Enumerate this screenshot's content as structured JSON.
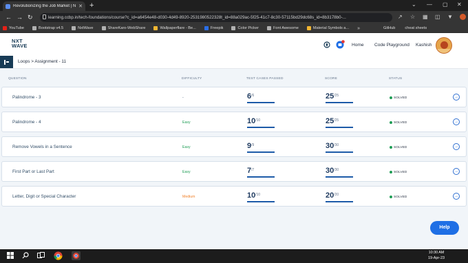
{
  "browser": {
    "tab_title": "Revolutionizing the Job Market | N",
    "tab_close": "✕",
    "new_tab": "+",
    "url": "learning.ccbp.in/tech-foundations/course?c_id=a6454e48-d030-4d49-8920-2531980522328t_id=88a029ac-5f25-41c7-8c30-57115bd29dc68s_id=8b3178b0-...",
    "window_controls": [
      "⌄",
      "—",
      "▢",
      "✕"
    ],
    "bookmarks": [
      "YouTube",
      "Bootstrap v4.5",
      "NxtWave",
      "ShareKaro-WebShare",
      "Wallpaperflare - Be...",
      "Freepik",
      "Color Picker",
      "Font Awesome",
      "Material Symbols a..."
    ],
    "bookmarks_overflow": "»",
    "bookmarks_right": [
      "GitHub",
      "cheat sheets"
    ],
    "colors": {
      "chrome_dark": "#353535",
      "tabstrip": "#1f1f1f"
    }
  },
  "header": {
    "logo_line1": "NXT",
    "logo_line2": "WAVE",
    "nav": [
      "Home",
      "Code Playground"
    ],
    "user_name": "Kashish",
    "notification_count": "1"
  },
  "breadcrumb": "Loops > Assignment - 11",
  "table": {
    "columns": [
      "QUESTION",
      "DIFFICULTY",
      "TEST CASES PASSED",
      "SCORE",
      "STATUS"
    ],
    "rows": [
      {
        "question": "Palindrome - 3",
        "difficulty": "-",
        "difficulty_level": "none",
        "passed": "6",
        "passed_total": "/6",
        "score": "25",
        "score_total": "/25",
        "status": "SOLVED"
      },
      {
        "question": "Palindrome - 4",
        "difficulty": "Easy",
        "difficulty_level": "easy",
        "passed": "10",
        "passed_total": "/10",
        "score": "25",
        "score_total": "/25",
        "status": "SOLVED"
      },
      {
        "question": "Remove Vowels in a Sentence",
        "difficulty": "Easy",
        "difficulty_level": "easy",
        "passed": "9",
        "passed_total": "/9",
        "score": "30",
        "score_total": "/30",
        "status": "SOLVED"
      },
      {
        "question": "First Part or Last Part",
        "difficulty": "Easy",
        "difficulty_level": "easy",
        "passed": "7",
        "passed_total": "/7",
        "score": "30",
        "score_total": "/30",
        "status": "SOLVED"
      },
      {
        "question": "Letter, Digit or Special Character",
        "difficulty": "Medium",
        "difficulty_level": "medium",
        "passed": "10",
        "passed_total": "/10",
        "score": "20",
        "score_total": "/20",
        "status": "SOLVED"
      }
    ]
  },
  "help_label": "Help",
  "taskbar": {
    "time": "10:30 AM",
    "date": "19-Apr-23"
  },
  "colors": {
    "brand_navy": "#183b56",
    "accent_blue": "#1f6fe5",
    "easy": "#1f9d55",
    "medium": "#f0822b",
    "solved": "#1f9d55"
  }
}
